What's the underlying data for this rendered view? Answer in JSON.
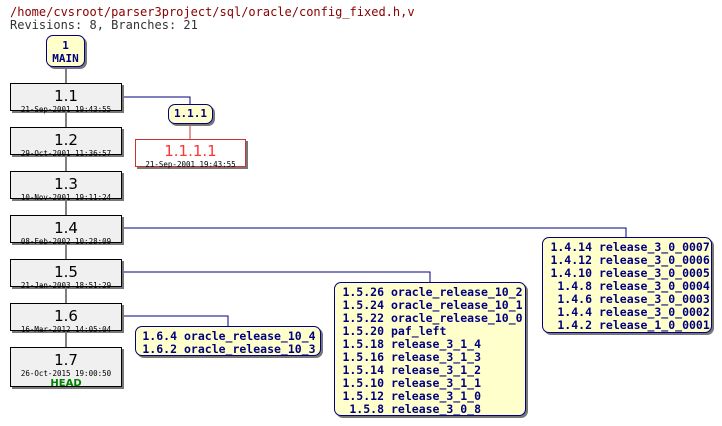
{
  "header": {
    "path": "/home/cvsroot/parser3project/sql/oracle/config_fixed.h,v",
    "stats": "Revisions: 8, Branches: 21"
  },
  "trunk": {
    "number": "1",
    "name": "MAIN"
  },
  "revisions": [
    {
      "rev": "1.1",
      "date": "21-Sep-2001 19:43:55"
    },
    {
      "rev": "1.2",
      "date": "29-Oct-2001 11:36:57"
    },
    {
      "rev": "1.3",
      "date": "10-Nov-2001 19:11:24"
    },
    {
      "rev": "1.4",
      "date": "08-Feb-2002 10:28:09"
    },
    {
      "rev": "1.5",
      "date": "21-Jan-2003 18:51:29"
    },
    {
      "rev": "1.6",
      "date": "16-Mar-2012 14:05:04"
    },
    {
      "rev": "1.7",
      "date": "26-Oct-2015 19:00:50",
      "tag": "HEAD"
    }
  ],
  "branch": {
    "number": "1.1.1",
    "revision": "1.1.1.1",
    "date": "21-Sep-2001 19:43:55"
  },
  "tag_groups": {
    "rev_1_4": [
      {
        "rev": "1.4.14",
        "name": "release_3_0_0007"
      },
      {
        "rev": "1.4.12",
        "name": "release_3_0_0006"
      },
      {
        "rev": "1.4.10",
        "name": "release_3_0_0005"
      },
      {
        "rev": "1.4.8",
        "name": "release_3_0_0004"
      },
      {
        "rev": "1.4.6",
        "name": "release_3_0_0003"
      },
      {
        "rev": "1.4.4",
        "name": "release_3_0_0002"
      },
      {
        "rev": "1.4.2",
        "name": "release_1_0_0001"
      }
    ],
    "rev_1_5": [
      {
        "rev": "1.5.26",
        "name": "oracle_release_10_2"
      },
      {
        "rev": "1.5.24",
        "name": "oracle_release_10_1"
      },
      {
        "rev": "1.5.22",
        "name": "oracle_release_10_0"
      },
      {
        "rev": "1.5.20",
        "name": "paf_left"
      },
      {
        "rev": "1.5.18",
        "name": "release_3_1_4"
      },
      {
        "rev": "1.5.16",
        "name": "release_3_1_3"
      },
      {
        "rev": "1.5.14",
        "name": "release_3_1_2"
      },
      {
        "rev": "1.5.10",
        "name": "release_3_1_1"
      },
      {
        "rev": "1.5.12",
        "name": "release_3_1_0"
      },
      {
        "rev": "1.5.8",
        "name": "release_3_0_8"
      }
    ],
    "rev_1_6": [
      {
        "rev": "1.6.4",
        "name": "oracle_release_10_4"
      },
      {
        "rev": "1.6.2",
        "name": "oracle_release_10_3"
      }
    ]
  },
  "colors": {
    "trunk_edge": "#000000",
    "branch_edge": "#000080",
    "branch_revision": "#ff3333",
    "tag_text": "#000080",
    "tag_fill": "#ffffcc",
    "head_tag": "#008000",
    "revision_fill": "#f0f0f0"
  }
}
